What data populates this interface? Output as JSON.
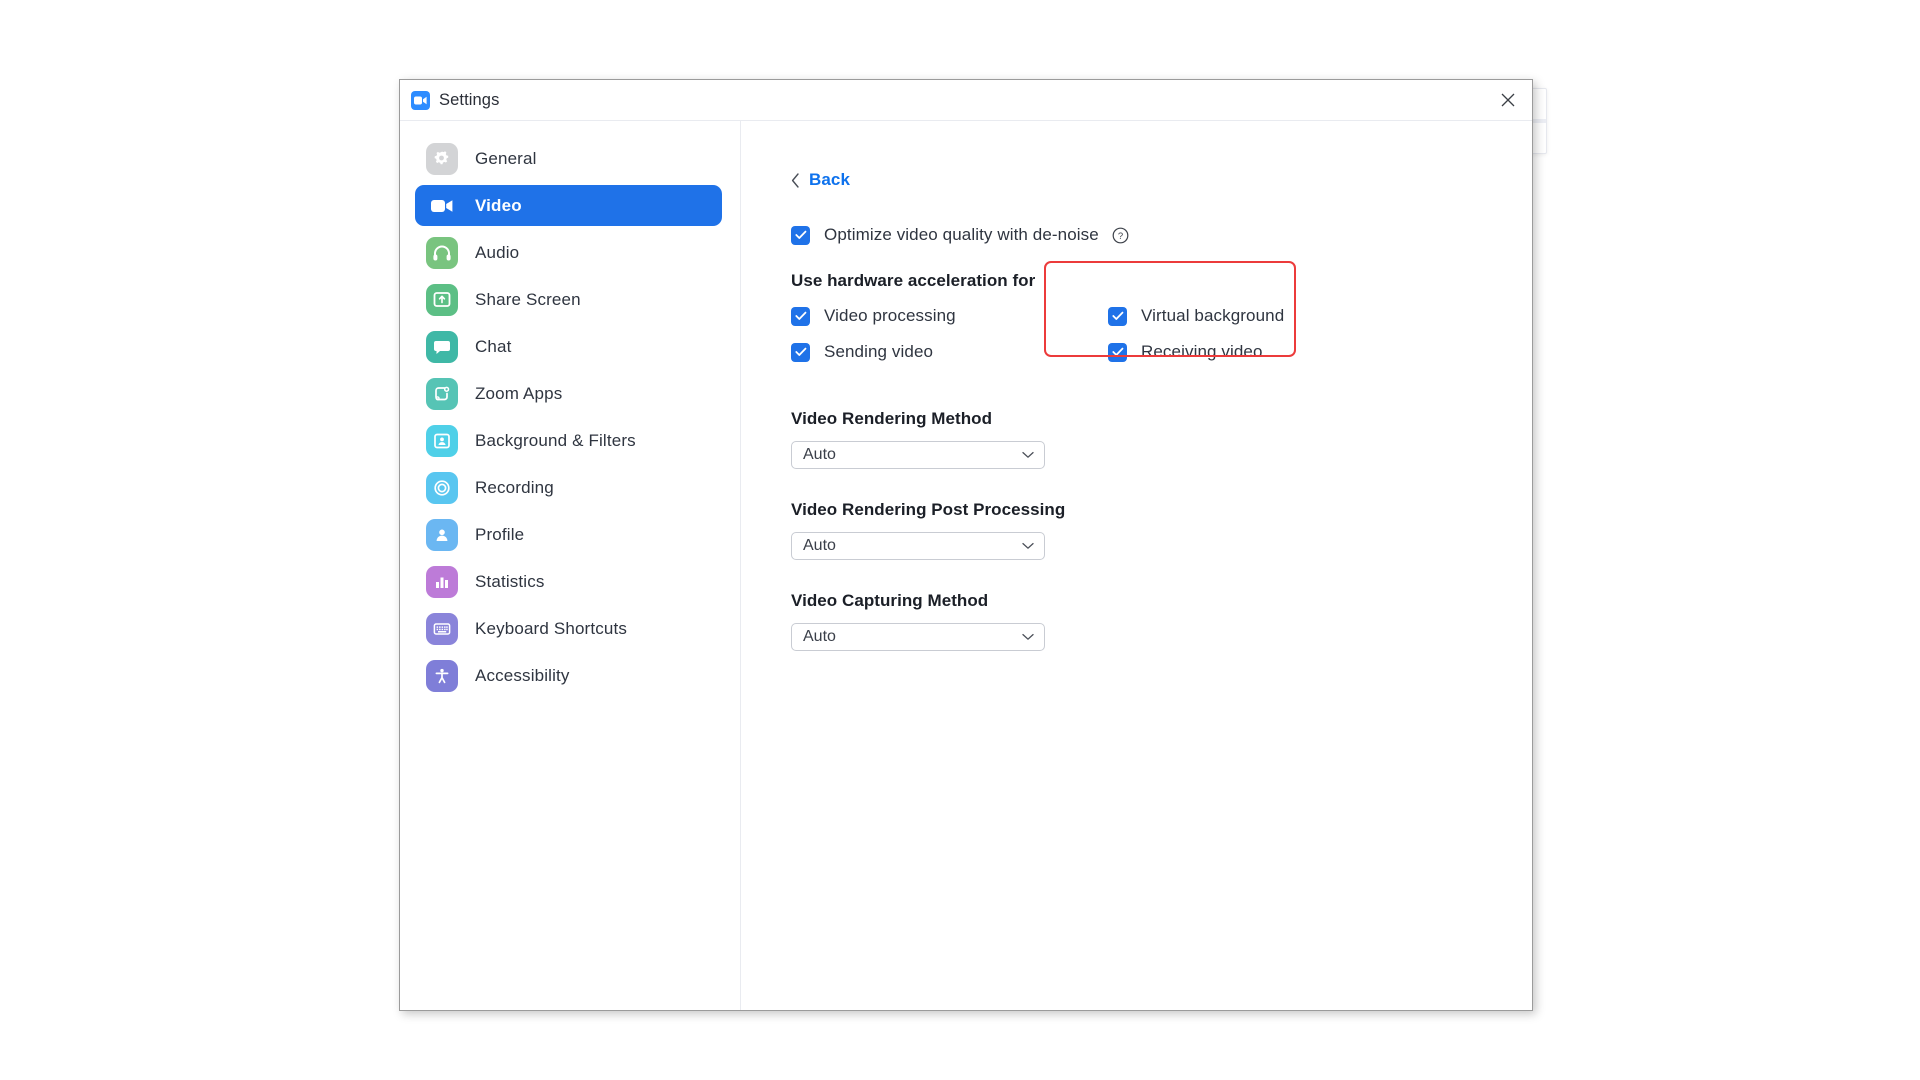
{
  "window": {
    "title": "Settings",
    "app_icon": "zoom-camera-icon",
    "close_icon": "close-icon"
  },
  "sidebar": {
    "items": [
      {
        "label": "General",
        "icon": "gear-icon",
        "color": "#d3d4d6",
        "active": false
      },
      {
        "label": "Video",
        "icon": "video-camera-icon",
        "color": "#1f72e8",
        "active": true
      },
      {
        "label": "Audio",
        "icon": "headphones-icon",
        "color": "#79c47f",
        "active": false
      },
      {
        "label": "Share Screen",
        "icon": "share-screen-icon",
        "color": "#5cbf85",
        "active": false
      },
      {
        "label": "Chat",
        "icon": "chat-bubble-icon",
        "color": "#3fb8a6",
        "active": false
      },
      {
        "label": "Zoom Apps",
        "icon": "zoom-apps-icon",
        "color": "#56c4b5",
        "active": false
      },
      {
        "label": "Background & Filters",
        "icon": "person-frame-icon",
        "color": "#4fd0e8",
        "active": false
      },
      {
        "label": "Recording",
        "icon": "record-circle-icon",
        "color": "#59c6f0",
        "active": false
      },
      {
        "label": "Profile",
        "icon": "person-icon",
        "color": "#6bb7f2",
        "active": false
      },
      {
        "label": "Statistics",
        "icon": "bar-chart-icon",
        "color": "#bd7bd8",
        "active": false
      },
      {
        "label": "Keyboard Shortcuts",
        "icon": "keyboard-icon",
        "color": "#8a84da",
        "active": false
      },
      {
        "label": "Accessibility",
        "icon": "accessibility-icon",
        "color": "#7f7ed8",
        "active": false
      }
    ]
  },
  "main": {
    "back": {
      "label": "Back",
      "icon": "chevron-left-icon"
    },
    "optimize": {
      "label": "Optimize video quality with de-noise",
      "checked": true,
      "help_icon": "question-mark-circle-icon"
    },
    "hardware": {
      "title": "Use hardware acceleration for",
      "left_options": [
        {
          "label": "Video processing",
          "checked": true
        },
        {
          "label": "Sending video",
          "checked": true
        }
      ],
      "right_options": [
        {
          "label": "Virtual background",
          "checked": true
        },
        {
          "label": "Receiving video",
          "checked": true
        }
      ],
      "highlight_color": "#ec3b3b"
    },
    "fields": [
      {
        "label": "Video Rendering Method",
        "value": "Auto"
      },
      {
        "label": "Video Rendering Post Processing",
        "value": "Auto"
      },
      {
        "label": "Video Capturing Method",
        "value": "Auto"
      }
    ]
  },
  "colors": {
    "accent": "#1f72e8",
    "link": "#0e72ed",
    "highlight": "#ec3b3b",
    "text": "#2f3540"
  }
}
